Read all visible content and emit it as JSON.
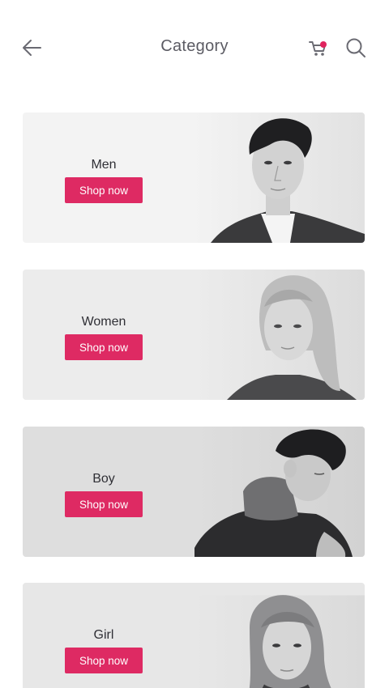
{
  "header": {
    "title": "Category",
    "back_icon": "arrow-left-icon",
    "cart_icon": "cart-icon",
    "search_icon": "search-icon",
    "cart_badge_color": "#e0245e"
  },
  "categories": [
    {
      "label": "Men",
      "button": "Shop now"
    },
    {
      "label": "Women",
      "button": "Shop now"
    },
    {
      "label": "Boy",
      "button": "Shop now"
    },
    {
      "label": "Girl",
      "button": "Shop now"
    }
  ],
  "colors": {
    "accent": "#de2a63",
    "title_text": "#5b5b63",
    "card_text": "#2f2f35"
  }
}
